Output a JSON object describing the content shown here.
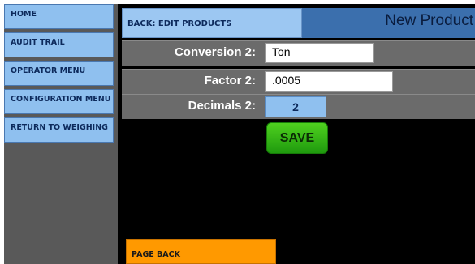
{
  "sidebar": {
    "items": [
      {
        "label": "HOME"
      },
      {
        "label": "AUDIT TRAIL"
      },
      {
        "label": "OPERATOR MENU"
      },
      {
        "label": "CONFIGURATION MENU"
      },
      {
        "label": "RETURN TO WEIGHING"
      }
    ]
  },
  "header": {
    "back_label": "BACK: EDIT PRODUCTS",
    "title": "New Product"
  },
  "form": {
    "conversion": {
      "label": "Conversion 2:",
      "value": "Ton"
    },
    "factor": {
      "label": "Factor 2:",
      "value": ".0005"
    },
    "decimals": {
      "label": "Decimals 2:",
      "value": "2"
    }
  },
  "actions": {
    "save_label": "SAVE",
    "page_back_label": "PAGE BACK"
  },
  "colors": {
    "nav_button": "#8fc0ef",
    "header_bar": "#3b6fad",
    "save_green": "#2fb014",
    "page_back_orange": "#ff9900"
  }
}
